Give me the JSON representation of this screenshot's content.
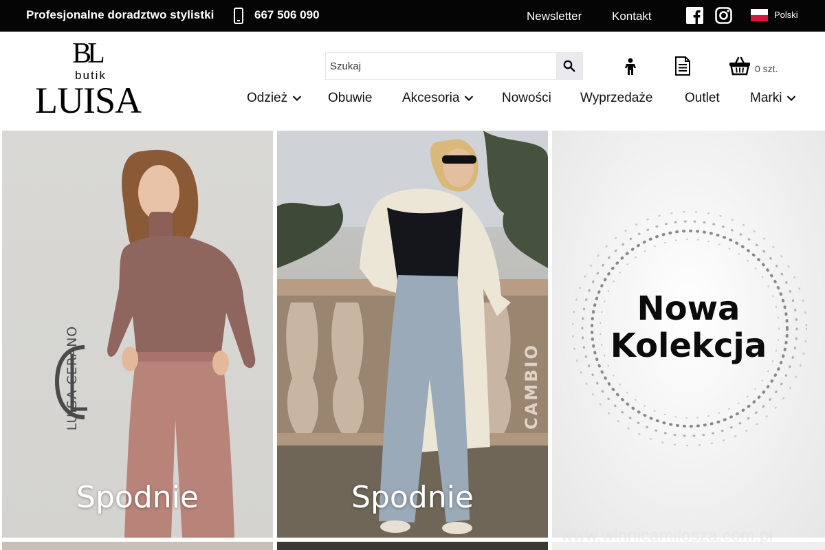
{
  "topbar": {
    "stylist_text": "Profesjonalne doradztwo stylistki",
    "phone": "667 506 090",
    "links": {
      "newsletter": "Newsletter",
      "kontakt": "Kontakt"
    },
    "language": "Polski",
    "icons": {
      "phone": "mobile-phone-icon",
      "facebook": "facebook-icon",
      "instagram": "instagram-icon",
      "flag": "poland-flag-icon"
    }
  },
  "logo": {
    "monogram": "BL",
    "butik": "butik",
    "name": "LUISA"
  },
  "search": {
    "placeholder": "Szukaj"
  },
  "header_icons": {
    "account": "person-icon",
    "list": "document-icon",
    "cart": "basket-icon"
  },
  "cart": {
    "count_label": "0 szt."
  },
  "nav": {
    "items": [
      {
        "label": "Odzież",
        "has_dropdown": true
      },
      {
        "label": "Obuwie",
        "has_dropdown": false
      },
      {
        "label": "Akcesoria",
        "has_dropdown": true
      },
      {
        "label": "Nowości",
        "has_dropdown": false
      },
      {
        "label": "Wyprzedaże",
        "has_dropdown": false
      },
      {
        "label": "Outlet",
        "has_dropdown": false
      },
      {
        "label": "Marki",
        "has_dropdown": true
      }
    ]
  },
  "tiles": [
    {
      "label": "Spodnie",
      "brand": "LUISA CERANO"
    },
    {
      "label": "Spodnie",
      "brand": "CAMBIO"
    },
    {
      "label": "Nowa Kolekcja"
    }
  ],
  "watermark": "www.winnicamilosza.com.pl",
  "colors": {
    "topbar_bg": "#050505",
    "accent_red": "#dc143c",
    "search_button_bg": "#e9e9ee"
  }
}
